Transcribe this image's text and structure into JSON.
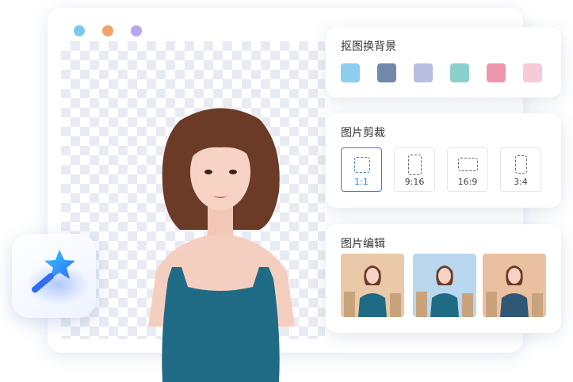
{
  "window": {
    "dots": [
      "#7ec8f0",
      "#f0a36a",
      "#b9a6f2"
    ]
  },
  "background_panel": {
    "title": "抠图换背景",
    "swatches": [
      "#8ccdf0",
      "#7089a8",
      "#b8bde2",
      "#8bd0cc",
      "#ee96ad",
      "#f6cbd6"
    ]
  },
  "crop_panel": {
    "title": "图片剪裁",
    "ratios": [
      {
        "label": "1:1",
        "selected": true
      },
      {
        "label": "9:16",
        "selected": false
      },
      {
        "label": "16:9",
        "selected": false
      },
      {
        "label": "3:4",
        "selected": false
      }
    ]
  },
  "edit_panel": {
    "title": "图片编辑",
    "thumbnails": [
      {
        "background": "#e9c9a8"
      },
      {
        "background": "#b9d7ee"
      },
      {
        "background": "#e9c0a0"
      }
    ]
  },
  "colors": {
    "accent": "#3a7bd5",
    "dress": "#1f6b86"
  },
  "icons": {
    "magic_wand": "magic-wand-icon"
  }
}
